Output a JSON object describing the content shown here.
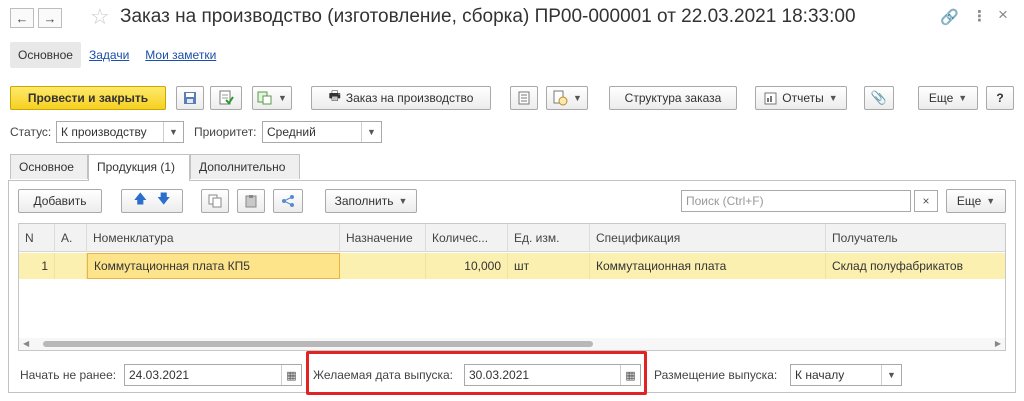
{
  "window": {
    "title": "Заказ на производство (изготовление, сборка) ПР00-000001 от 22.03.2021 18:33:00",
    "back_icon": "arrow-left-icon",
    "forward_icon": "arrow-right-icon",
    "star_icon": "star-icon",
    "link_icon": "link-icon",
    "more_icon": "more-vertical-icon",
    "close_icon": "close-icon"
  },
  "subnav": {
    "main": "Основное",
    "tasks": "Задачи",
    "notes": "Мои заметки"
  },
  "toolbar": {
    "post_close": "Провести и закрыть",
    "production_order": "Заказ на производство",
    "order_structure": "Структура заказа",
    "reports": "Отчеты",
    "more": "Еще",
    "help": "?"
  },
  "status": {
    "status_label": "Статус:",
    "status_value": "К производству",
    "priority_label": "Приоритет:",
    "priority_value": "Средний"
  },
  "tabs": {
    "main": "Основное",
    "products": "Продукция (1)",
    "extra": "Дополнительно"
  },
  "grid_toolbar": {
    "add": "Добавить",
    "fill": "Заполнить",
    "search_placeholder": "Поиск (Ctrl+F)",
    "clear": "×",
    "more": "Еще"
  },
  "table": {
    "columns": [
      "N",
      "A.",
      "Номенклатура",
      "Назначение",
      "Количес...",
      "Ед. изм.",
      "Спецификация",
      "Получатель"
    ],
    "rows": [
      {
        "n": "1",
        "a": "",
        "item": "Коммутационная плата КП5",
        "purpose": "",
        "qty": "10,000",
        "unit": "шт",
        "spec": "Коммутационная плата",
        "receiver": "Склад полуфабрикатов"
      }
    ]
  },
  "dates": {
    "start_label": "Начать не ранее:",
    "start_value": "24.03.2021",
    "desired_label": "Желаемая дата выпуска:",
    "desired_value": "30.03.2021",
    "placement_label": "Размещение выпуска:",
    "placement_value": "К началу"
  },
  "colors": {
    "accent_yellow": "#f6d020",
    "selected_row": "#fbf0b0",
    "highlight_red": "#e02424",
    "link_blue": "#1b4fa8"
  }
}
